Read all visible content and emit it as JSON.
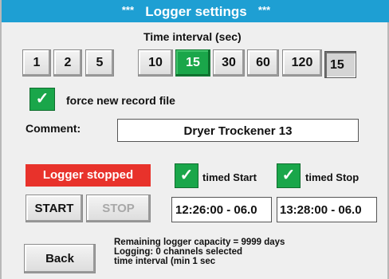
{
  "title": {
    "stars_left": "***",
    "text": "Logger settings",
    "stars_right": "***"
  },
  "interval": {
    "label": "Time interval (sec)",
    "options": [
      "1",
      "2",
      "5",
      "10",
      "15",
      "30",
      "60",
      "120"
    ],
    "selected": "15",
    "custom_value": "15"
  },
  "force_new_file": {
    "checked": true,
    "check_glyph": "✓",
    "label": "force new record file"
  },
  "comment": {
    "label": "Comment:",
    "value": "Dryer Trockener 13"
  },
  "logger": {
    "status": "Logger stopped",
    "status_color": "#e8322b",
    "start_label": "START",
    "stop_label": "STOP"
  },
  "timed_start": {
    "checked": true,
    "label": "timed Start",
    "value": "12:26:00 - 06.0"
  },
  "timed_stop": {
    "checked": true,
    "label": "timed Stop",
    "value": "13:28:00 - 06.0"
  },
  "info": {
    "line1": "Remaining logger capacity = 9999 days",
    "line2": "Logging: 0 channels selected",
    "line3": "time interval (min 1 sec"
  },
  "back_label": "Back",
  "colors": {
    "title_bar": "#1e9fd3",
    "active": "#1aa64a",
    "alert": "#e8322b"
  }
}
